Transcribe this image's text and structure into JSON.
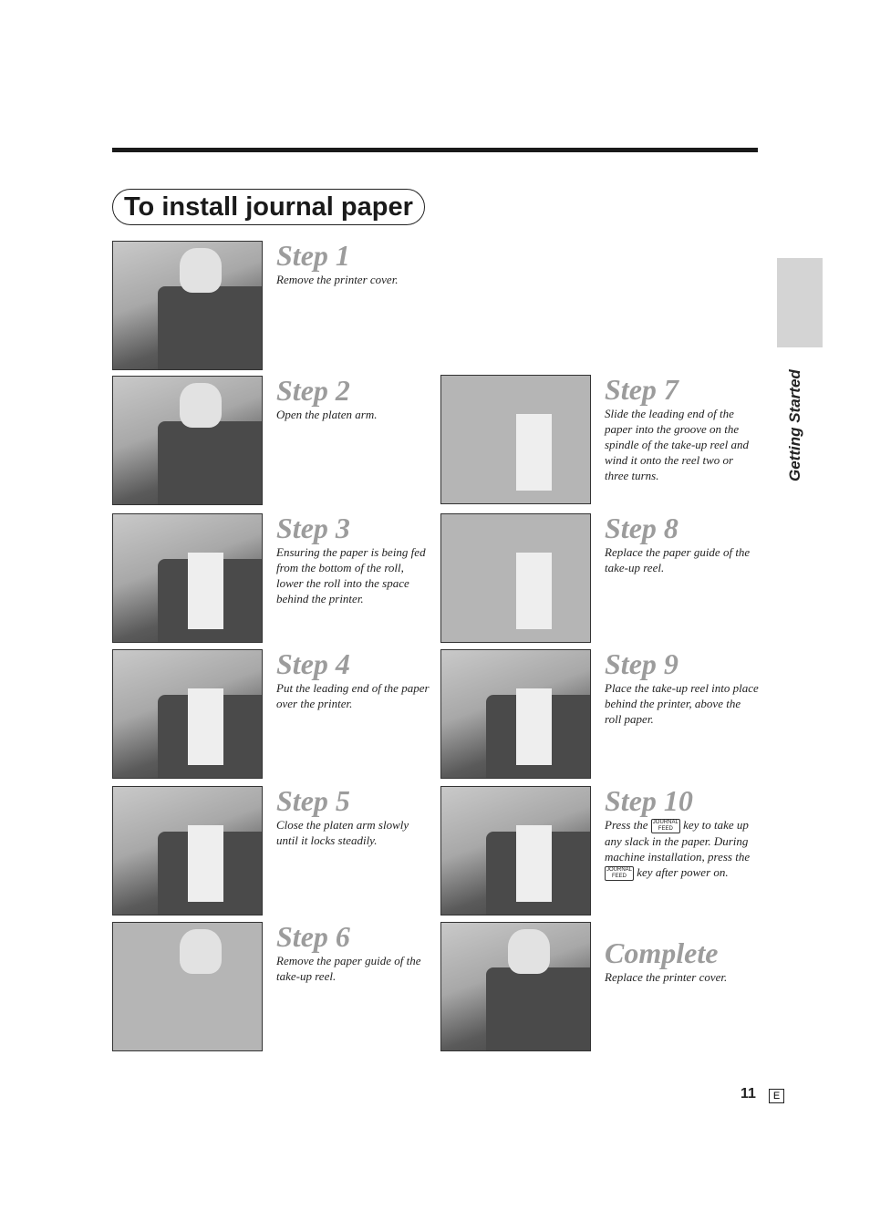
{
  "page": {
    "title": "To install journal paper",
    "section_tab": "Getting Started",
    "page_number": "11",
    "language_marker": "E"
  },
  "key_label": {
    "top": "JOURNAL",
    "bottom": "FEED"
  },
  "steps": [
    {
      "title": "Step 1",
      "desc": "Remove the printer cover.",
      "photo": "removing-printer-cover"
    },
    {
      "title": "Step 2",
      "desc": "Open the platen arm.",
      "photo": "opening-platen-arm"
    },
    {
      "title": "Step 3",
      "desc": "Ensuring the paper is being fed from the bottom of the roll, lower the roll into the space behind the printer.",
      "photo": "lowering-paper-roll"
    },
    {
      "title": "Step 4",
      "desc": "Put the leading end of the paper over the printer.",
      "photo": "paper-over-printer"
    },
    {
      "title": "Step 5",
      "desc": "Close the platen arm slowly until it locks steadily.",
      "photo": "closing-platen-arm"
    },
    {
      "title": "Step 6",
      "desc": "Remove the paper guide of the take-up reel.",
      "photo": "removing-paper-guide"
    },
    {
      "title": "Step 7",
      "desc": "Slide the leading end of the paper into the groove on the spindle of the take-up reel and wind it onto the reel two or three turns.",
      "photo": "winding-paper-on-reel"
    },
    {
      "title": "Step 8",
      "desc": "Replace the paper guide of the take-up reel.",
      "photo": "replacing-paper-guide"
    },
    {
      "title": "Step 9",
      "desc": "Place the take-up reel into place behind the printer, above the roll paper.",
      "photo": "placing-take-up-reel"
    },
    {
      "title": "Step 10",
      "desc_parts": [
        "Press the",
        "key to take up any slack in the paper. During machine installation, press the",
        "key after power on."
      ],
      "photo": "pressing-journal-feed-key"
    },
    {
      "title": "Complete",
      "desc": "Replace the printer cover.",
      "photo": "replacing-printer-cover"
    }
  ]
}
